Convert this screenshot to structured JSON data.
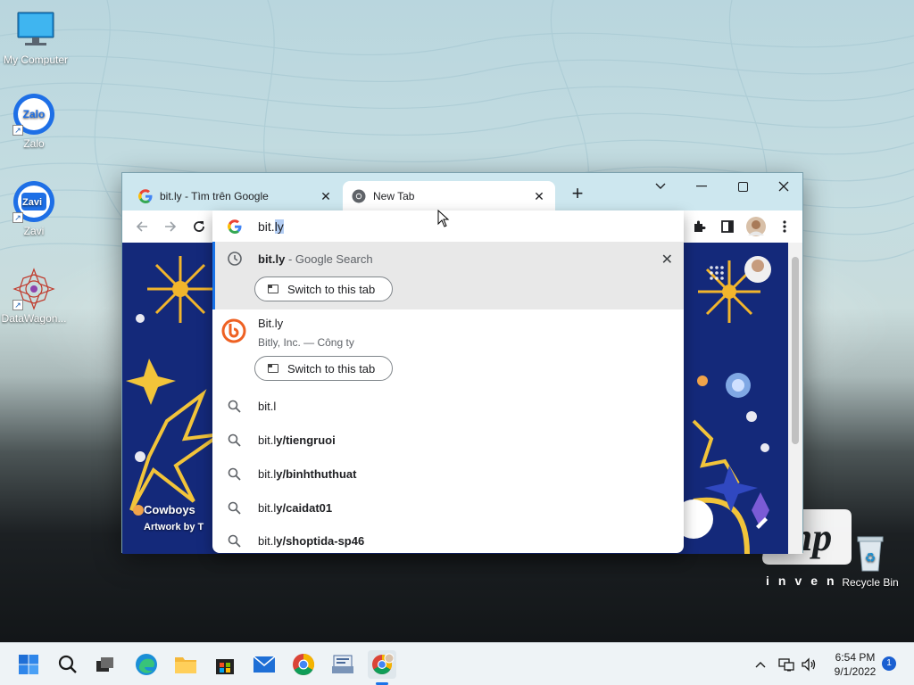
{
  "desktop": {
    "icons": [
      {
        "label": "My Computer"
      },
      {
        "label": "Zalo",
        "glyph": "Zalo"
      },
      {
        "label": "Zavi",
        "glyph": "Zavi"
      },
      {
        "label": "DataWagon..."
      },
      {
        "label": "Recycle Bin"
      }
    ],
    "wallpaper_text": "inven"
  },
  "browser": {
    "tabs": [
      {
        "title": "bit.ly - Tìm trên Google",
        "active": false
      },
      {
        "title": "New Tab",
        "active": true
      }
    ],
    "window_controls": [
      "tab-search",
      "minimize",
      "maximize",
      "close"
    ],
    "omnibox": {
      "typed": "bit.",
      "autocomplete": "ly",
      "suggestions": [
        {
          "kind": "history",
          "main": "bit.ly",
          "secondary": " - Google Search",
          "button": "Switch to this tab"
        },
        {
          "kind": "site",
          "title": "Bit.ly",
          "subtitle": "Bitly, Inc. — Công ty",
          "button": "Switch to this tab"
        },
        {
          "kind": "search",
          "prefix": "bit.l",
          "suffix": ""
        },
        {
          "kind": "search",
          "prefix": "bit.l",
          "suffix": "y/tiengruoi"
        },
        {
          "kind": "search",
          "prefix": "bit.l",
          "suffix": "y/binhthuthuat"
        },
        {
          "kind": "search",
          "prefix": "bit.l",
          "suffix": "y/caidat01"
        },
        {
          "kind": "search",
          "prefix": "bit.l",
          "suffix": "y/shoptida-sp46"
        }
      ]
    },
    "page": {
      "caption_title": "Cowboys",
      "caption_sub": "Artwork by T"
    }
  },
  "taskbar": {
    "clock_time": "6:54 PM",
    "clock_date": "9/1/2022",
    "notification_count": "1"
  },
  "colors": {
    "tabstrip": "#cde7ef",
    "doodle_bg": "#14297a",
    "accent": "#1a73e8"
  }
}
